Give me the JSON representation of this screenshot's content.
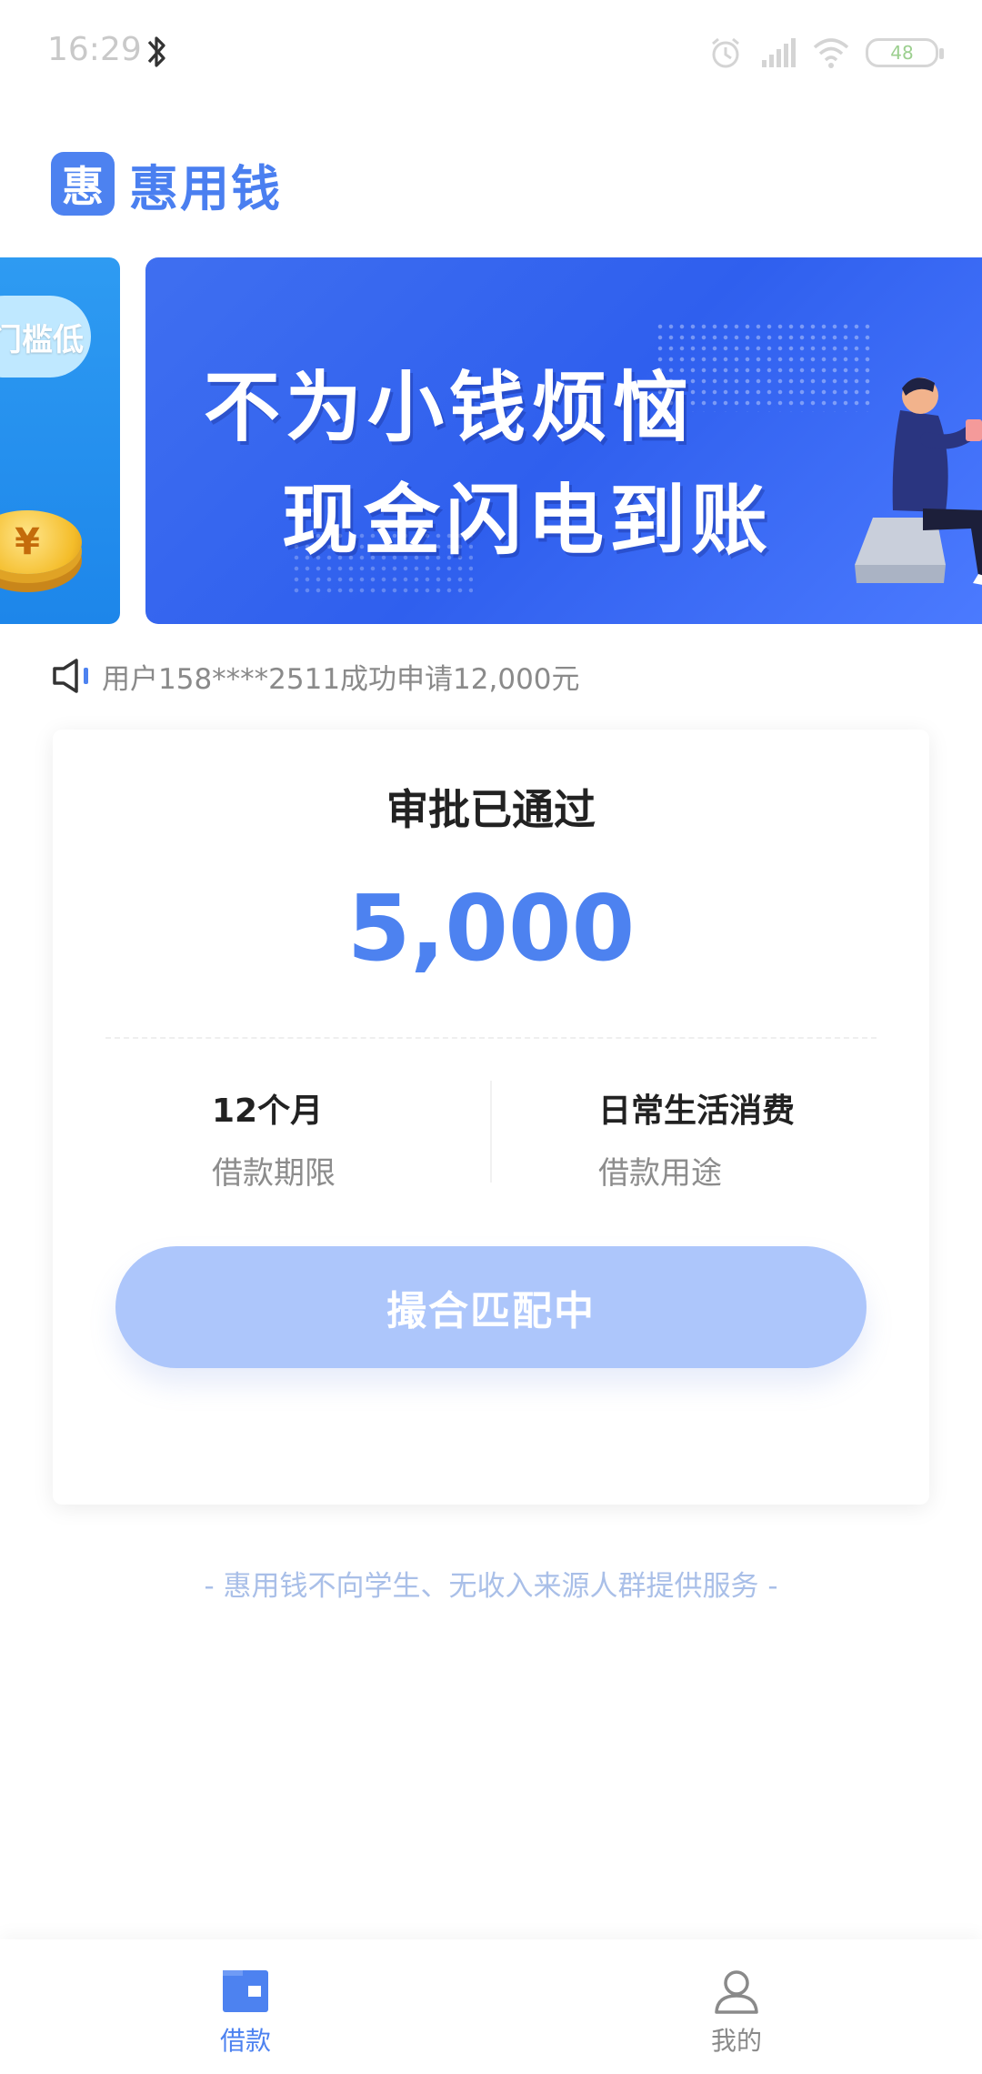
{
  "status_bar": {
    "time": "16:29",
    "battery": "48",
    "icons": [
      "bluetooth-icon",
      "alarm-icon",
      "signal-icon",
      "wifi-icon",
      "battery-icon"
    ]
  },
  "header": {
    "logo_char": "惠",
    "app_name": "惠用钱"
  },
  "banner": {
    "prev_slide_text": "门槛低",
    "prev_slide_coin": "¥",
    "line1": "不为小钱烦恼",
    "line2": "现金闪电到账"
  },
  "notice": {
    "icon": "speaker-icon",
    "text": "用户158****2511成功申请12,000元"
  },
  "card": {
    "status": "审批已通过",
    "amount": "5,000",
    "term_value": "12个月",
    "term_label": "借款期限",
    "purpose_value": "日常生活消费",
    "purpose_label": "借款用途",
    "button_label": "撮合匹配中"
  },
  "disclaimer": "- 惠用钱不向学生、无收入来源人群提供服务 -",
  "bottom_nav": {
    "items": [
      {
        "label": "借款",
        "icon": "loan-icon",
        "active": true
      },
      {
        "label": "我的",
        "icon": "user-icon",
        "active": false
      }
    ]
  },
  "colors": {
    "brand": "#4d82f0",
    "button_disabled": "#adc6fb",
    "disclaimer": "#a9bfe8"
  }
}
